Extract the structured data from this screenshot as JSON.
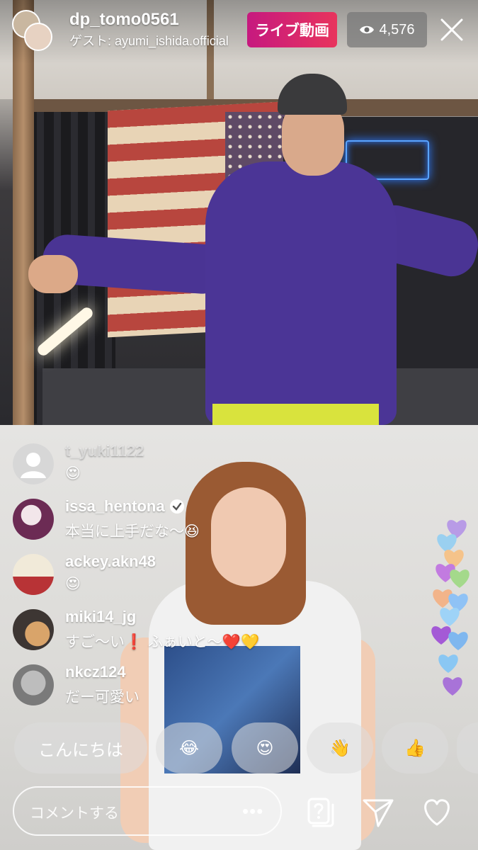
{
  "header": {
    "host_username": "dp_tomo0561",
    "guest_label": "ゲスト: ayumi_ishida.official",
    "live_label": "ライブ動画",
    "viewer_count": "4,576",
    "close_icon": "close-icon"
  },
  "comments": [
    {
      "user": "t_yuki1122",
      "text": "😍",
      "verified": false
    },
    {
      "user": "issa_hentona",
      "text": "本当に上手だな〜😆",
      "verified": true
    },
    {
      "user": "ackey.akn48",
      "text": "😍",
      "verified": false
    },
    {
      "user": "miki14_jg",
      "text": "すご〜い❗️ ふぁいと〜❤️💛",
      "verified": false
    },
    {
      "user": "nkcz124",
      "text": "だー可愛い",
      "verified": false
    }
  ],
  "quick_replies": [
    "こんにちは",
    "😂",
    "😍",
    "👋",
    "👍"
  ],
  "composer": {
    "placeholder": "コメントする",
    "more_label": "•••"
  },
  "icons": {
    "question": "question-card-icon",
    "share": "send-icon",
    "like": "heart-icon"
  },
  "colors": {
    "live_gradient_start": "#c6197f",
    "live_gradient_end": "#e8345d",
    "viewer_badge": "#787878"
  }
}
